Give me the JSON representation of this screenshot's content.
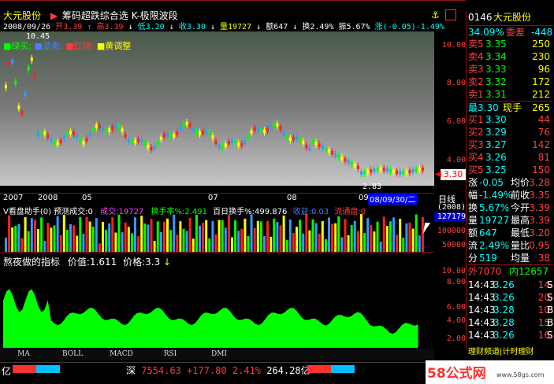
{
  "title_bar": {
    "stock_name": "大元股份",
    "indicator_name": "筹码超跌综合选 K-极限波段"
  },
  "info_line": {
    "date": "2008/09/26",
    "open": "开3.39",
    "high": "高3.39",
    "low": "低3.20",
    "close": "收3.30",
    "volume": "量19727",
    "amount": "额647",
    "turnover": "换2.49%",
    "amplitude": "振5.67%",
    "change": "涨(-0.05)-1.49%"
  },
  "price_overlay": "10.45",
  "legend": {
    "green": "绿买;",
    "blue": "蓝卖;",
    "red": "红持;",
    "yellow": "黄调整"
  },
  "main_axis": [
    "10.00",
    "8.00",
    "6.00",
    "4.00"
  ],
  "current_price_tag": "3.30",
  "low_marker": "2.83",
  "date_axis": [
    "2007",
    "2008",
    "05",
    "07",
    "08",
    "09"
  ],
  "highlight_date": "08/09/30/二",
  "period_label": "日线",
  "vol_header": {
    "title": "V看盘助手(0) 预测成交:0",
    "deal": "成交:19727",
    "turn": "换手率%:2.491",
    "hundred": "百日换手%:499.876",
    "rise": "收益:0.03",
    "flow": "流通盘:0"
  },
  "vol_axis": [
    "(2008)",
    "127179",
    "100000",
    "50000"
  ],
  "ind_header": {
    "title": "熬夜做的指标",
    "value": "价值:1.611",
    "price": "价格:3.3"
  },
  "ind_axis": [
    "10.00",
    "8.00",
    "6.00",
    "4.00",
    "2.00"
  ],
  "tabs": [
    "MA",
    "BOLL",
    "MACD",
    "RSI",
    "DMI"
  ],
  "status": {
    "market": "深",
    "index": "7554.63",
    "change": "+177.80",
    "pct": "2.41%",
    "amount": "264.28亿",
    "left_amount": "亿"
  },
  "watermark": {
    "text": "58公式网",
    "url": "www.58gs.com"
  },
  "right_panel": {
    "code": "0146",
    "name": "大元股份",
    "ratio": "34.09%",
    "ratio_label": "委差",
    "ratio_val": "-448",
    "sells": [
      [
        "卖5",
        "3.35",
        "250"
      ],
      [
        "卖4",
        "3.34",
        "230"
      ],
      [
        "卖3",
        "3.33",
        "96"
      ],
      [
        "卖2",
        "3.32",
        "172"
      ],
      [
        "卖1",
        "3.31",
        "212"
      ]
    ],
    "latest": [
      "最3.30",
      "现手",
      "265"
    ],
    "buys": [
      [
        "买1",
        "3.30",
        "44"
      ],
      [
        "买2",
        "3.29",
        "76"
      ],
      [
        "买3",
        "3.27",
        "142"
      ],
      [
        "买4",
        "3.26",
        "81"
      ],
      [
        "买5",
        "3.25",
        "150"
      ]
    ],
    "stats": [
      [
        "涨",
        "-0.05",
        "均价",
        "3.28"
      ],
      [
        "幅",
        "-1.49%",
        "前收",
        "3.35"
      ],
      [
        "换",
        "5.67%",
        "今开",
        "3.39"
      ],
      [
        "量",
        "19727",
        "最高",
        "3.39"
      ],
      [
        "额",
        "647",
        "最低",
        "3.20"
      ],
      [
        "流",
        "2.49%",
        "量比",
        "0.95"
      ],
      [
        "分",
        "519",
        "均量",
        "38"
      ]
    ],
    "outin": [
      "外7070",
      "内12657"
    ],
    "ticks": [
      [
        "14:43",
        "3.26",
        "14",
        "S"
      ],
      [
        "14:43",
        "3.26",
        "20",
        "S"
      ],
      [
        "14:43",
        "3.28",
        "10",
        "B"
      ],
      [
        "14:43",
        "3.28",
        "15",
        "B"
      ],
      [
        "14:43",
        "3.26",
        "16",
        "S"
      ]
    ],
    "bottom_link": "理财频道|计时理财"
  }
}
